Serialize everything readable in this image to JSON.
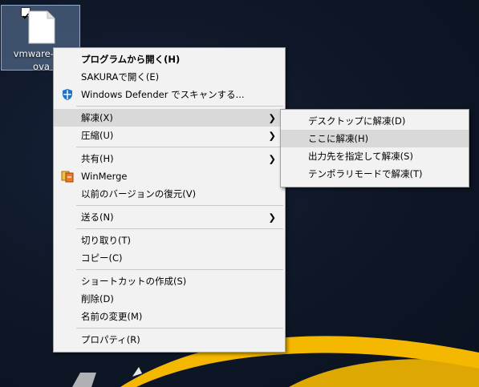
{
  "desktop": {
    "file_icon": {
      "name_line1": "vmware-sec",
      "name_line2": "ova",
      "checked": true
    }
  },
  "context_menu": {
    "items": [
      {
        "label": "プログラムから開く(H)",
        "bold": true
      },
      {
        "label": "SAKURAで開く(E)"
      },
      {
        "label": "Windows Defender でスキャンする...",
        "icon": "windows-defender-shield-icon"
      },
      {
        "label": "解凍(X)",
        "highlighted": true,
        "has_submenu": true
      },
      {
        "label": "圧縮(U)",
        "has_submenu": true
      },
      {
        "label": "共有(H)",
        "has_submenu": true
      },
      {
        "label": "WinMerge",
        "icon": "winmerge-icon"
      },
      {
        "label": "以前のバージョンの復元(V)"
      },
      {
        "label": "送る(N)",
        "has_submenu": true
      },
      {
        "label": "切り取り(T)"
      },
      {
        "label": "コピー(C)"
      },
      {
        "label": "ショートカットの作成(S)"
      },
      {
        "label": "削除(D)"
      },
      {
        "label": "名前の変更(M)"
      },
      {
        "label": "プロパティ(R)"
      }
    ]
  },
  "submenu": {
    "items": [
      {
        "label": "デスクトップに解凍(D)"
      },
      {
        "label": "ここに解凍(H)",
        "highlighted": true
      },
      {
        "label": "出力先を指定して解凍(S)"
      },
      {
        "label": "テンポラリモードで解凍(T)"
      }
    ]
  },
  "colors": {
    "menu_bg": "#f2f2f2",
    "highlight": "#d9d9d9",
    "desktop_bg": "#0d1524",
    "wallpaper_accent": "#f5b800"
  }
}
